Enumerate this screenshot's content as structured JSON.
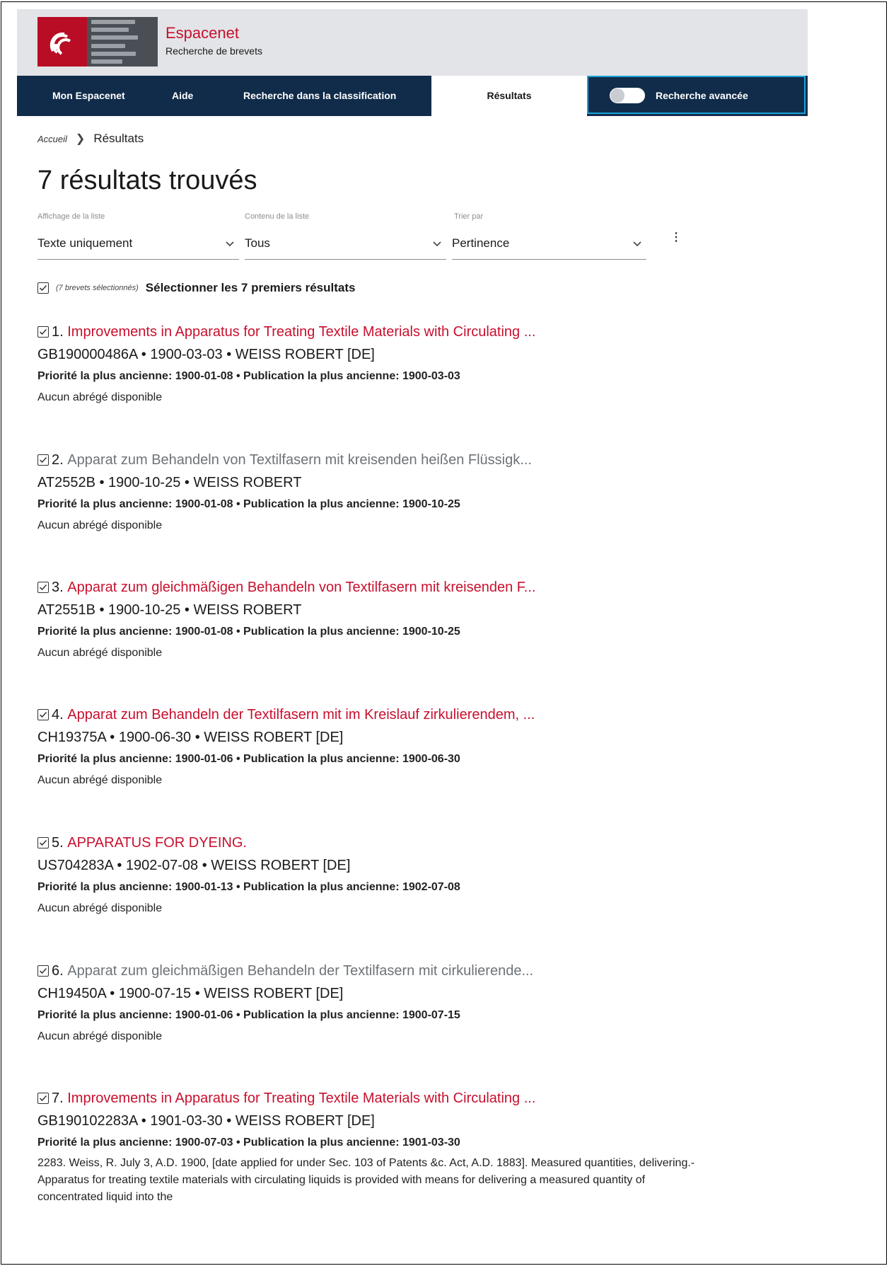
{
  "header": {
    "brand": "Espacenet",
    "subtitle": "Recherche de brevets"
  },
  "nav": {
    "items": [
      "Mon Espacenet",
      "Aide",
      "Recherche dans la classification",
      "Résultats"
    ],
    "active": "Résultats",
    "advanced_label": "Recherche avancée",
    "advanced_toggle_on": false
  },
  "breadcrumb": {
    "home": "Accueil",
    "current": "Résultats"
  },
  "page_title": "7 résultats trouvés",
  "controls": {
    "display": {
      "caption": "Affichage de la liste",
      "value": "Texte uniquement"
    },
    "content": {
      "caption": "Contenu de la liste",
      "value": "Tous"
    },
    "sort": {
      "caption": "Trier par",
      "value": "Pertinence"
    }
  },
  "selection": {
    "note": "(7 brevets sélectionnés)",
    "label": "Sélectionner les 7 premiers résultats"
  },
  "results": [
    {
      "num": "1.",
      "title": "Improvements in Apparatus for Treating Textile Materials with Circulating ...",
      "meta": "GB190000486A • 1900-03-03 • WEISS ROBERT [DE]",
      "priority": "Priorité la plus ancienne: 1900-01-08 • Publication la plus ancienne: 1900-03-03",
      "abstract": "Aucun abrégé disponible"
    },
    {
      "num": "2.",
      "title": "Apparat zum Behandeln von Textilfasern mit kreisenden heißen Flüssigk...",
      "meta": "AT2552B • 1900-10-25 • WEISS ROBERT",
      "priority": "Priorité la plus ancienne: 1900-01-08 • Publication la plus ancienne: 1900-10-25",
      "abstract": "Aucun abrégé disponible"
    },
    {
      "num": "3.",
      "title": "Apparat zum gleichmäßigen Behandeln von Textilfasern mit kreisenden F...",
      "meta": "AT2551B • 1900-10-25 • WEISS ROBERT",
      "priority": "Priorité la plus ancienne: 1900-01-08 • Publication la plus ancienne: 1900-10-25",
      "abstract": "Aucun abrégé disponible"
    },
    {
      "num": "4.",
      "title": "Apparat zum Behandeln der Textilfasern mit im Kreislauf zirkulierendem, ...",
      "meta": "CH19375A • 1900-06-30 • WEISS ROBERT [DE]",
      "priority": "Priorité la plus ancienne: 1900-01-06 • Publication la plus ancienne: 1900-06-30",
      "abstract": "Aucun abrégé disponible"
    },
    {
      "num": "5.",
      "title": "APPARATUS FOR DYEING.",
      "meta": "US704283A • 1902-07-08 • WEISS ROBERT [DE]",
      "priority": "Priorité la plus ancienne: 1900-01-13 • Publication la plus ancienne: 1902-07-08",
      "abstract": "Aucun abrégé disponible"
    },
    {
      "num": "6.",
      "title": "Apparat zum gleichmäßigen Behandeln der Textilfasern mit cirkulierende...",
      "meta": "CH19450A • 1900-07-15 • WEISS ROBERT [DE]",
      "priority": "Priorité la plus ancienne: 1900-01-06 • Publication la plus ancienne: 1900-07-15",
      "abstract": "Aucun abrégé disponible"
    },
    {
      "num": "7.",
      "title": "Improvements in Apparatus for Treating Textile Materials with Circulating ...",
      "meta": "GB190102283A • 1901-03-30 • WEISS ROBERT [DE]",
      "priority": "Priorité la plus ancienne: 1900-07-03 • Publication la plus ancienne: 1901-03-30",
      "abstract": "2283. Weiss, R. July 3, A.D. 1900, [date applied for under Sec. 103 of Patents &c. Act, A.D. 1883]. Measured quantities, delivering.-Apparatus for treating textile materials with circulating liquids is provided with means for delivering a measured quantity of concentrated liquid into the"
    }
  ],
  "icons": {
    "checkbox": "checkbox-checked-icon",
    "chevron": "chevron-down-icon",
    "breadcrumb_sep": "chevron-right-icon",
    "more": "kebab-menu-icon"
  },
  "colors": {
    "accent": "#c8102e",
    "nav_bg": "#112c4a",
    "header_bg": "#e3e4e8",
    "focus": "#1aa3d9",
    "visited_title": "#6e7378"
  }
}
